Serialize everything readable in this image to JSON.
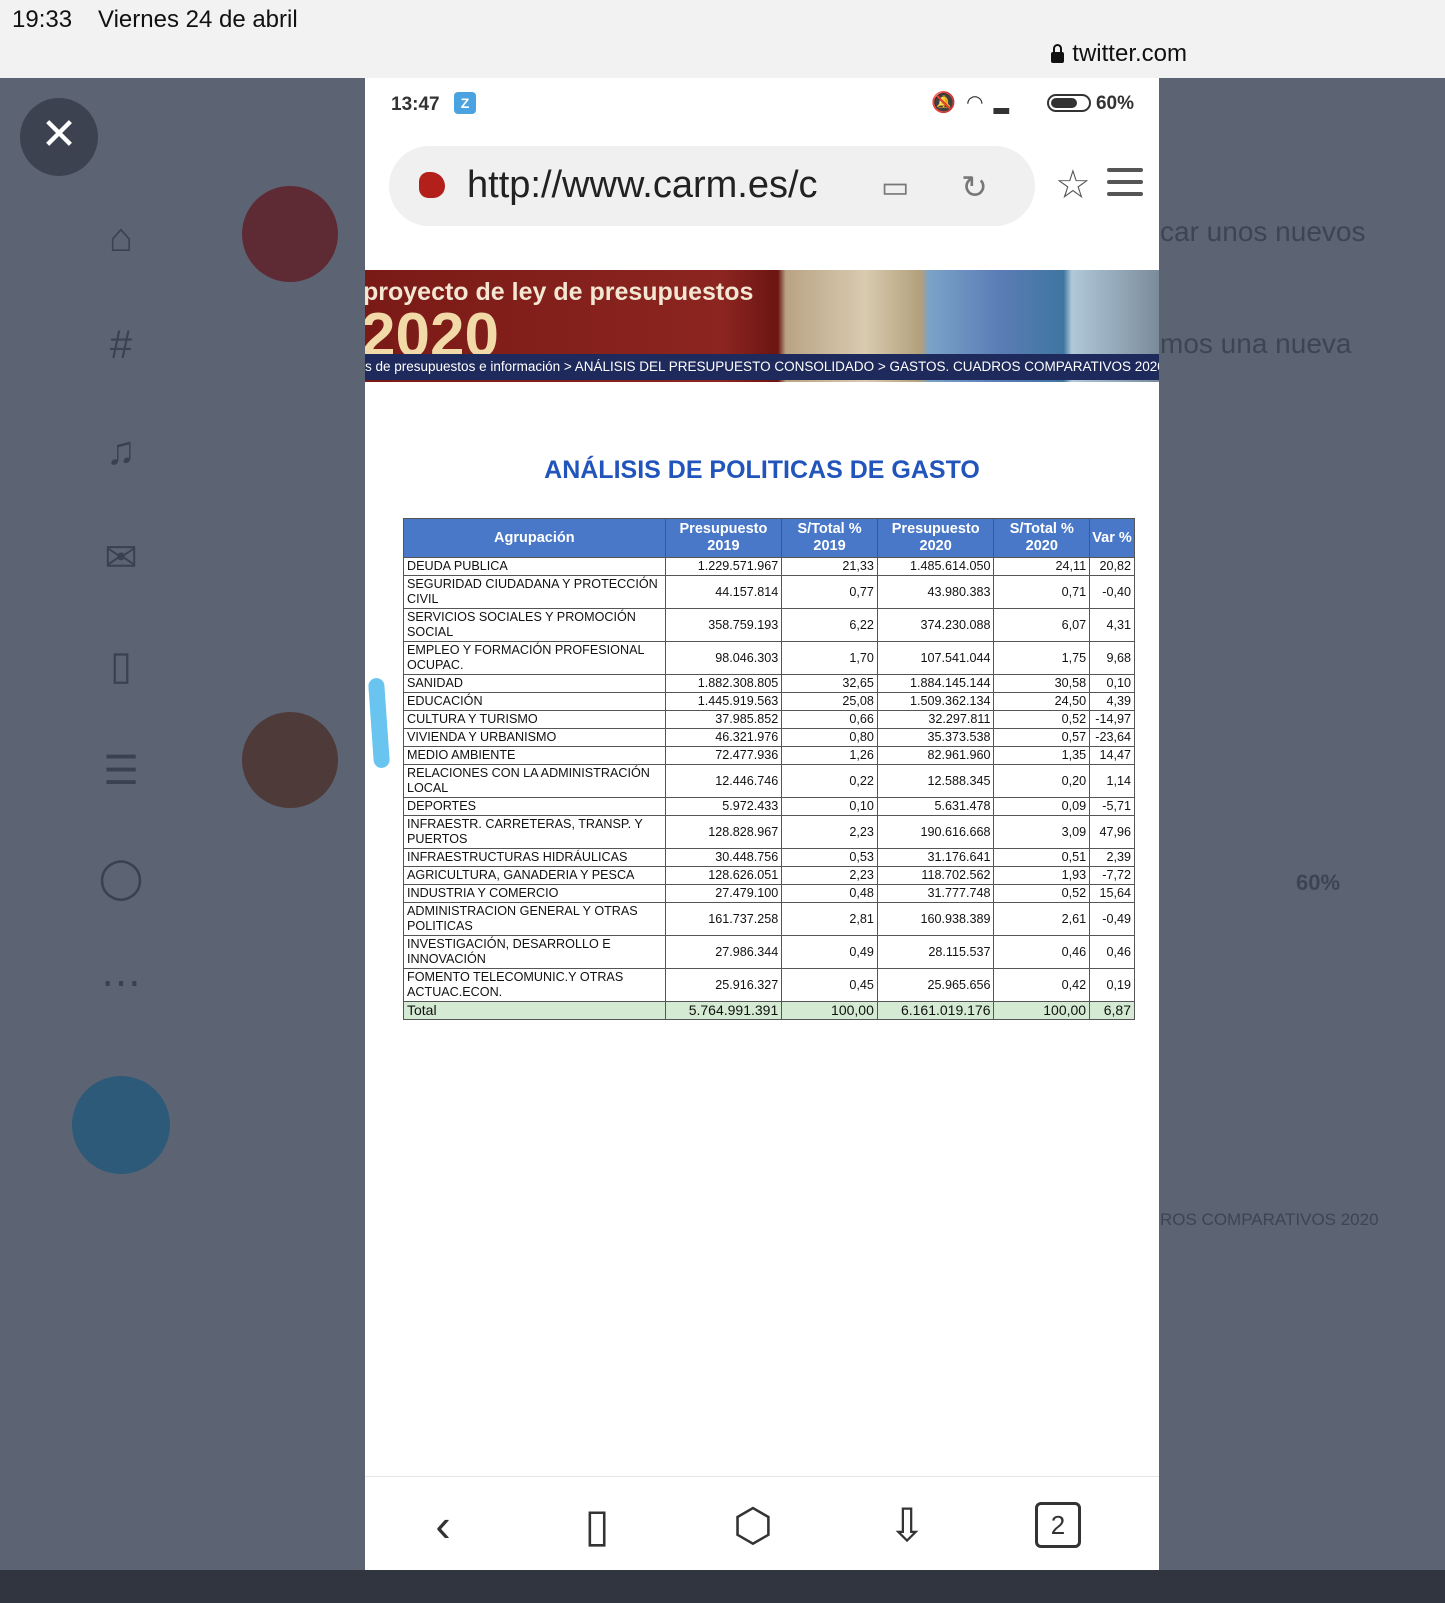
{
  "ipad": {
    "time": "19:33",
    "date": "Viernes 24 de abril",
    "domain": "twitter.com"
  },
  "background": {
    "snippet1": "car unos nuevos",
    "snippet2": "mos una nueva",
    "snippet3": "60%",
    "snippet4": "ROS COMPARATIVOS 2020"
  },
  "phone": {
    "time": "13:47",
    "battery": "60%",
    "url": "http://www.carm.es/c",
    "banner_title": "proyecto de ley de presupuestos",
    "banner_year": "2020",
    "breadcrumb": "s de presupuestos e información > ANÁLISIS DEL PRESUPUESTO CONSOLIDADO > GASTOS. CUADROS COMPARATIVOS 2020",
    "tabs_count": "2"
  },
  "table": {
    "title": "ANÁLISIS DE POLITICAS DE GASTO",
    "headers": [
      "Agrupación",
      "Presupuesto 2019",
      "S/Total % 2019",
      "Presupuesto 2020",
      "S/Total % 2020",
      "Var %"
    ],
    "rows": [
      [
        "DEUDA PUBLICA",
        "1.229.571.967",
        "21,33",
        "1.485.614.050",
        "24,11",
        "20,82"
      ],
      [
        "SEGURIDAD CIUDADANA Y PROTECCIÓN CIVIL",
        "44.157.814",
        "0,77",
        "43.980.383",
        "0,71",
        "-0,40"
      ],
      [
        "SERVICIOS SOCIALES Y PROMOCIÓN SOCIAL",
        "358.759.193",
        "6,22",
        "374.230.088",
        "6,07",
        "4,31"
      ],
      [
        "EMPLEO Y FORMACIÓN PROFESIONAL OCUPAC.",
        "98.046.303",
        "1,70",
        "107.541.044",
        "1,75",
        "9,68"
      ],
      [
        "SANIDAD",
        "1.882.308.805",
        "32,65",
        "1.884.145.144",
        "30,58",
        "0,10"
      ],
      [
        "EDUCACIÓN",
        "1.445.919.563",
        "25,08",
        "1.509.362.134",
        "24,50",
        "4,39"
      ],
      [
        "CULTURA Y TURISMO",
        "37.985.852",
        "0,66",
        "32.297.811",
        "0,52",
        "-14,97"
      ],
      [
        "VIVIENDA Y URBANISMO",
        "46.321.976",
        "0,80",
        "35.373.538",
        "0,57",
        "-23,64"
      ],
      [
        "MEDIO AMBIENTE",
        "72.477.936",
        "1,26",
        "82.961.960",
        "1,35",
        "14,47"
      ],
      [
        "RELACIONES CON LA ADMINISTRACIÓN LOCAL",
        "12.446.746",
        "0,22",
        "12.588.345",
        "0,20",
        "1,14"
      ],
      [
        "DEPORTES",
        "5.972.433",
        "0,10",
        "5.631.478",
        "0,09",
        "-5,71"
      ],
      [
        "INFRAESTR. CARRETERAS, TRANSP. Y PUERTOS",
        "128.828.967",
        "2,23",
        "190.616.668",
        "3,09",
        "47,96"
      ],
      [
        "INFRAESTRUCTURAS HIDRÁULICAS",
        "30.448.756",
        "0,53",
        "31.176.641",
        "0,51",
        "2,39"
      ],
      [
        "AGRICULTURA, GANADERIA Y PESCA",
        "128.626.051",
        "2,23",
        "118.702.562",
        "1,93",
        "-7,72"
      ],
      [
        "INDUSTRIA Y COMERCIO",
        "27.479.100",
        "0,48",
        "31.777.748",
        "0,52",
        "15,64"
      ],
      [
        "ADMINISTRACION GENERAL Y OTRAS POLITICAS",
        "161.737.258",
        "2,81",
        "160.938.389",
        "2,61",
        "-0,49"
      ],
      [
        "INVESTIGACIÓN, DESARROLLO E INNOVACIÓN",
        "27.986.344",
        "0,49",
        "28.115.537",
        "0,46",
        "0,46"
      ],
      [
        "FOMENTO TELECOMUNIC.Y OTRAS ACTUAC.ECON.",
        "25.916.327",
        "0,45",
        "25.965.656",
        "0,42",
        "0,19"
      ]
    ],
    "total": [
      "Total",
      "5.764.991.391",
      "100,00",
      "6.161.019.176",
      "100,00",
      "6,87"
    ]
  }
}
